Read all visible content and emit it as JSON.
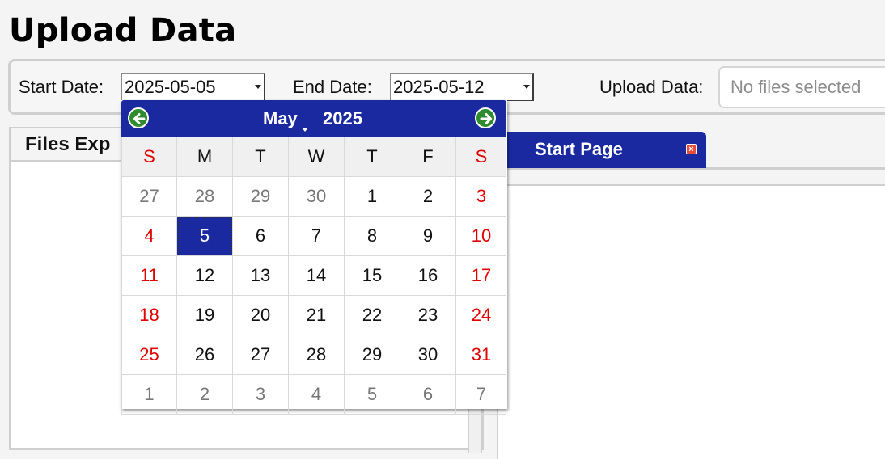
{
  "page": {
    "title": "Upload Data"
  },
  "toolbar": {
    "start_label": "Start Date:",
    "start_value": "2025-05-05",
    "end_label": "End Date:",
    "end_value": "2025-05-12",
    "upload_label": "Upload Data:",
    "upload_placeholder": "No files selected"
  },
  "files_panel": {
    "title": "Files Exp"
  },
  "tabs": [
    {
      "label": "Start Page",
      "close_icon": "close-icon"
    }
  ],
  "calendar": {
    "month": "May",
    "year": "2025",
    "prev_icon": "arrow-left-icon",
    "next_icon": "arrow-right-icon",
    "weekdays": [
      "S",
      "M",
      "T",
      "W",
      "T",
      "F",
      "S"
    ],
    "weeks": [
      [
        "27",
        "28",
        "29",
        "30",
        "1",
        "2",
        "3"
      ],
      [
        "4",
        "5",
        "6",
        "7",
        "8",
        "9",
        "10"
      ],
      [
        "11",
        "12",
        "13",
        "14",
        "15",
        "16",
        "17"
      ],
      [
        "18",
        "19",
        "20",
        "21",
        "22",
        "23",
        "24"
      ],
      [
        "25",
        "26",
        "27",
        "28",
        "29",
        "30",
        "31"
      ],
      [
        "1",
        "2",
        "3",
        "4",
        "5",
        "6",
        "7"
      ]
    ],
    "selected_day": "5",
    "colors": {
      "header": "#1a29a0",
      "weekend": "#e00000",
      "nav": "#2e8b2e"
    }
  }
}
